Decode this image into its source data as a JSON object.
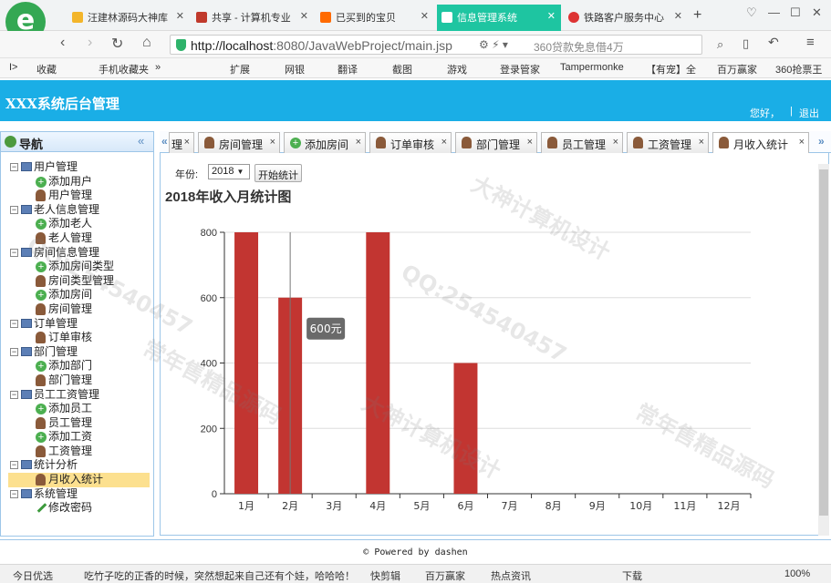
{
  "browser": {
    "tabs": [
      {
        "label": "汪建林源码大神库"
      },
      {
        "label": "共享 - 计算机专业"
      },
      {
        "label": "已买到的宝贝"
      },
      {
        "label": "信息管理系统"
      },
      {
        "label": "铁路客户服务中心"
      }
    ],
    "url_host": "http://localhost",
    "url_path": ":8080/JavaWebProject/main.jsp",
    "addr_hint": "360贷款免息借4万",
    "bookmarks": [
      "收藏",
      "手机收藏夹",
      "扩展",
      "网银",
      "翻译",
      "截图",
      "游戏",
      "登录管家",
      "Tampermonke",
      "【有宠】全",
      "百万赢家",
      "360抢票王"
    ]
  },
  "app": {
    "title": "XXX系统后台管理",
    "header_links": [
      "您好，",
      "|",
      "退出"
    ],
    "footer": "© Powered by dashen"
  },
  "nav": {
    "title": "导航",
    "groups": [
      {
        "label": "用户管理",
        "items": [
          "添加用户",
          "用户管理"
        ]
      },
      {
        "label": "老人信息管理",
        "items": [
          "添加老人",
          "老人管理"
        ]
      },
      {
        "label": "房间信息管理",
        "items": [
          "添加房间类型",
          "房间类型管理",
          "添加房间",
          "房间管理"
        ]
      },
      {
        "label": "订单管理",
        "items": [
          "订单审核"
        ]
      },
      {
        "label": "部门管理",
        "items": [
          "添加部门",
          "部门管理"
        ]
      },
      {
        "label": "员工工资管理",
        "items": [
          "添加员工",
          "员工管理",
          "添加工资",
          "工资管理"
        ]
      },
      {
        "label": "统计分析",
        "items": [
          "月收入统计"
        ]
      },
      {
        "label": "系统管理",
        "items": [
          "修改密码"
        ]
      }
    ]
  },
  "content_tabs": [
    {
      "label": "理"
    },
    {
      "label": "房间管理"
    },
    {
      "label": "添加房间"
    },
    {
      "label": "订单审核"
    },
    {
      "label": "部门管理"
    },
    {
      "label": "员工管理"
    },
    {
      "label": "工资管理"
    },
    {
      "label": "月收入统计"
    }
  ],
  "filter": {
    "year_label": "年份:",
    "year_value": "2018",
    "start_button": "开始统计"
  },
  "chart_data": {
    "type": "bar",
    "title": "2018年收入月统计图",
    "categories": [
      "1月",
      "2月",
      "3月",
      "4月",
      "5月",
      "6月",
      "7月",
      "8月",
      "9月",
      "10月",
      "11月",
      "12月"
    ],
    "values": [
      800,
      600,
      0,
      800,
      0,
      400,
      0,
      0,
      0,
      0,
      0,
      0
    ],
    "yticks": [
      0,
      200,
      400,
      600,
      800
    ],
    "ylim": [
      0,
      800
    ],
    "bar_color": "#c23531",
    "tooltip": "600元",
    "grid": true
  },
  "statusbar": {
    "items": [
      "今日优选",
      "吃竹子吃的正香的时候，突然想起来自己还有个娃，哈哈哈！",
      "快剪辑",
      "百万赢家",
      "热点资讯",
      "下载",
      "100%"
    ]
  },
  "watermarks": [
    "QQ:254540457",
    "大神计算机设计",
    "常年售精品源码"
  ]
}
